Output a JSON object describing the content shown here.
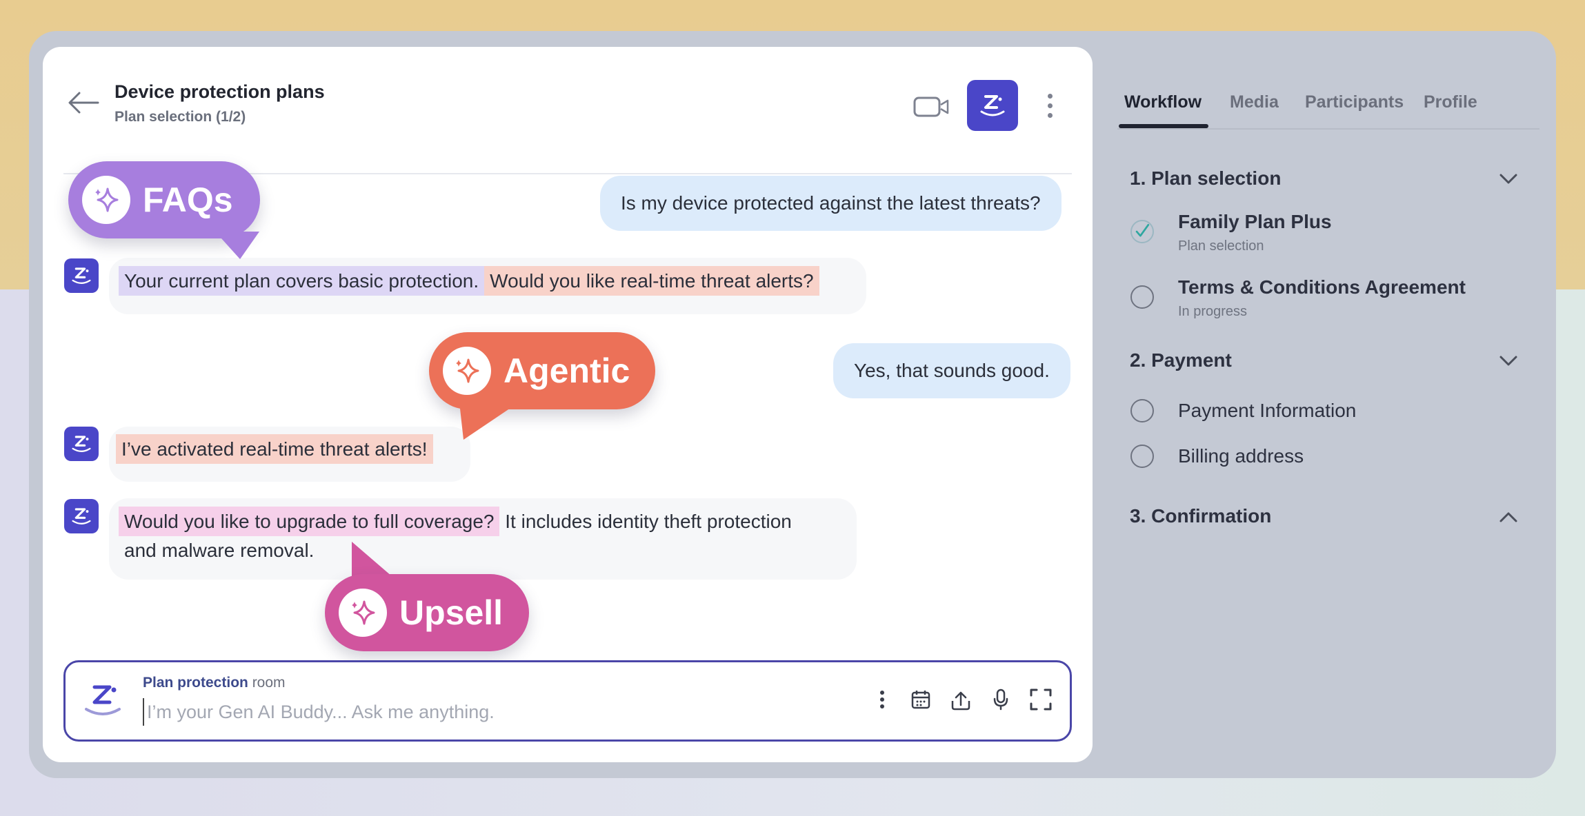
{
  "header": {
    "title": "Device protection plans",
    "subtitle": "Plan selection (1/2)"
  },
  "messages": [
    {
      "role": "user",
      "text": "Is my device protected against the latest threats?"
    },
    {
      "role": "bot",
      "parts": [
        "Your current plan covers basic protection.",
        "Would you like real-time threat alerts?"
      ]
    },
    {
      "role": "user",
      "text": "Yes, that sounds good."
    },
    {
      "role": "bot",
      "parts": [
        "I’ve activated real-time threat alerts!"
      ]
    },
    {
      "role": "bot",
      "parts": [
        "Would you like to upgrade to full coverage?",
        " It includes identity theft protection",
        "and malware removal."
      ]
    }
  ],
  "tags": {
    "faqs": "FAQs",
    "agentic": "Agentic",
    "upsell": "Upsell"
  },
  "composer": {
    "room_name": "Plan protection",
    "room_suffix": " room",
    "placeholder": "I’m your Gen AI Buddy... Ask me anything."
  },
  "tabs": [
    "Workflow",
    "Media",
    "Participants",
    "Profile"
  ],
  "workflow": {
    "sections": [
      {
        "title": "1. Plan selection",
        "steps": [
          {
            "title": "Family Plan Plus",
            "sub": "Plan selection",
            "done": true
          },
          {
            "title": "Terms & Conditions Agreement",
            "sub": "In progress",
            "done": false
          }
        ]
      },
      {
        "title": "2. Payment",
        "steps": [
          {
            "title": "Payment Information"
          },
          {
            "title": "Billing address"
          }
        ]
      },
      {
        "title": "3. Confirmation",
        "steps": []
      }
    ]
  },
  "colors": {
    "accent": "#4a46c8",
    "faqs_tag": "#a77ede",
    "agentic_tag": "#ec7158",
    "upsell_tag": "#d1559e",
    "user_bubble": "#dcebfb"
  }
}
